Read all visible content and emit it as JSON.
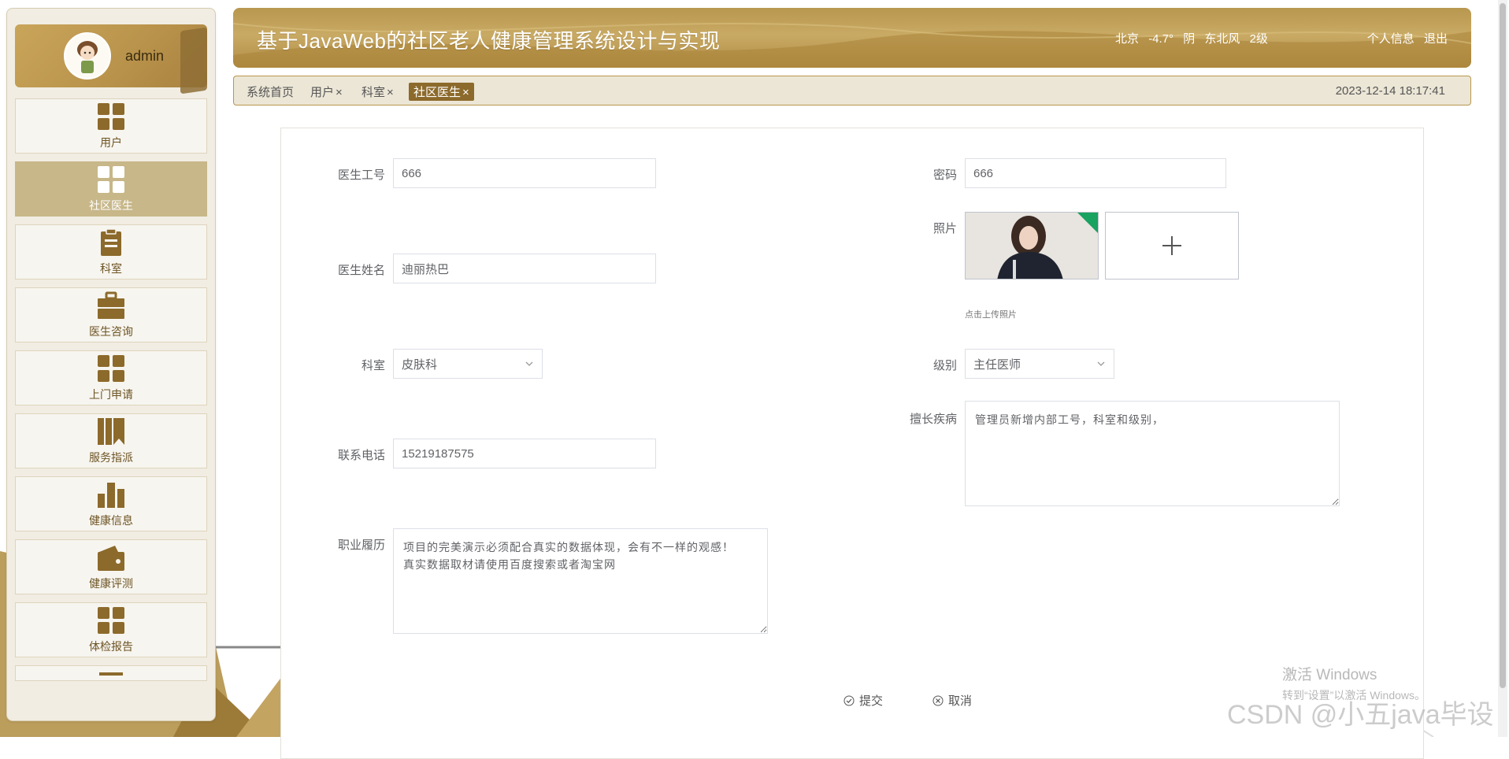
{
  "sidebar": {
    "username": "admin",
    "items": [
      {
        "label": "用户",
        "icon": "grid-icon",
        "active": false
      },
      {
        "label": "社区医生",
        "icon": "grid-icon",
        "active": true
      },
      {
        "label": "科室",
        "icon": "clipboard-icon",
        "active": false
      },
      {
        "label": "医生咨询",
        "icon": "briefcase-icon",
        "active": false
      },
      {
        "label": "上门申请",
        "icon": "grid-icon",
        "active": false
      },
      {
        "label": "服务指派",
        "icon": "books-icon",
        "active": false
      },
      {
        "label": "健康信息",
        "icon": "bar-chart-icon",
        "active": false
      },
      {
        "label": "健康评测",
        "icon": "wallet-icon",
        "active": false
      },
      {
        "label": "体检报告",
        "icon": "grid-icon",
        "active": false
      }
    ]
  },
  "header": {
    "title": "基于JavaWeb的社区老人健康管理系统设计与实现",
    "weather": {
      "city": "北京",
      "temp": "-4.7°",
      "condition": "阴",
      "wind": "东北风",
      "level": "2级"
    },
    "profile_link": "个人信息",
    "logout_link": "退出"
  },
  "tabs": {
    "items": [
      {
        "label": "系统首页",
        "closable": false,
        "active": false
      },
      {
        "label": "用户",
        "closable": true,
        "active": false
      },
      {
        "label": "科室",
        "closable": true,
        "active": false
      },
      {
        "label": "社区医生",
        "closable": true,
        "active": true
      }
    ],
    "close_glyph": "×",
    "datetime": "2023-12-14 18:17:41"
  },
  "form": {
    "doctor_id": {
      "label": "医生工号",
      "value": "666"
    },
    "password": {
      "label": "密码",
      "value": "666"
    },
    "photo": {
      "label": "照片",
      "hint": "点击上传照片"
    },
    "doctor_name": {
      "label": "医生姓名",
      "value": "迪丽热巴"
    },
    "department": {
      "label": "科室",
      "value": "皮肤科"
    },
    "level": {
      "label": "级别",
      "value": "主任医师"
    },
    "specialty": {
      "label": "擅长疾病",
      "value": "管理员新增内部工号，科室和级别，"
    },
    "phone": {
      "label": "联系电话",
      "value": "15219187575"
    },
    "career": {
      "label": "职业履历",
      "value": "项目的完美演示必须配合真实的数据体现，会有不一样的观感！\n真实数据取材请使用百度搜索或者淘宝网"
    },
    "submit_label": "提交",
    "cancel_label": "取消"
  },
  "watermark": {
    "line1": "激活 Windows",
    "line2": "转到“设置”以激活 Windows。",
    "csdn": "CSDN @小五java毕设"
  },
  "colors": {
    "accent": "#b8974f",
    "active_menu": "#c7b789",
    "icon": "#8c6a2b"
  }
}
